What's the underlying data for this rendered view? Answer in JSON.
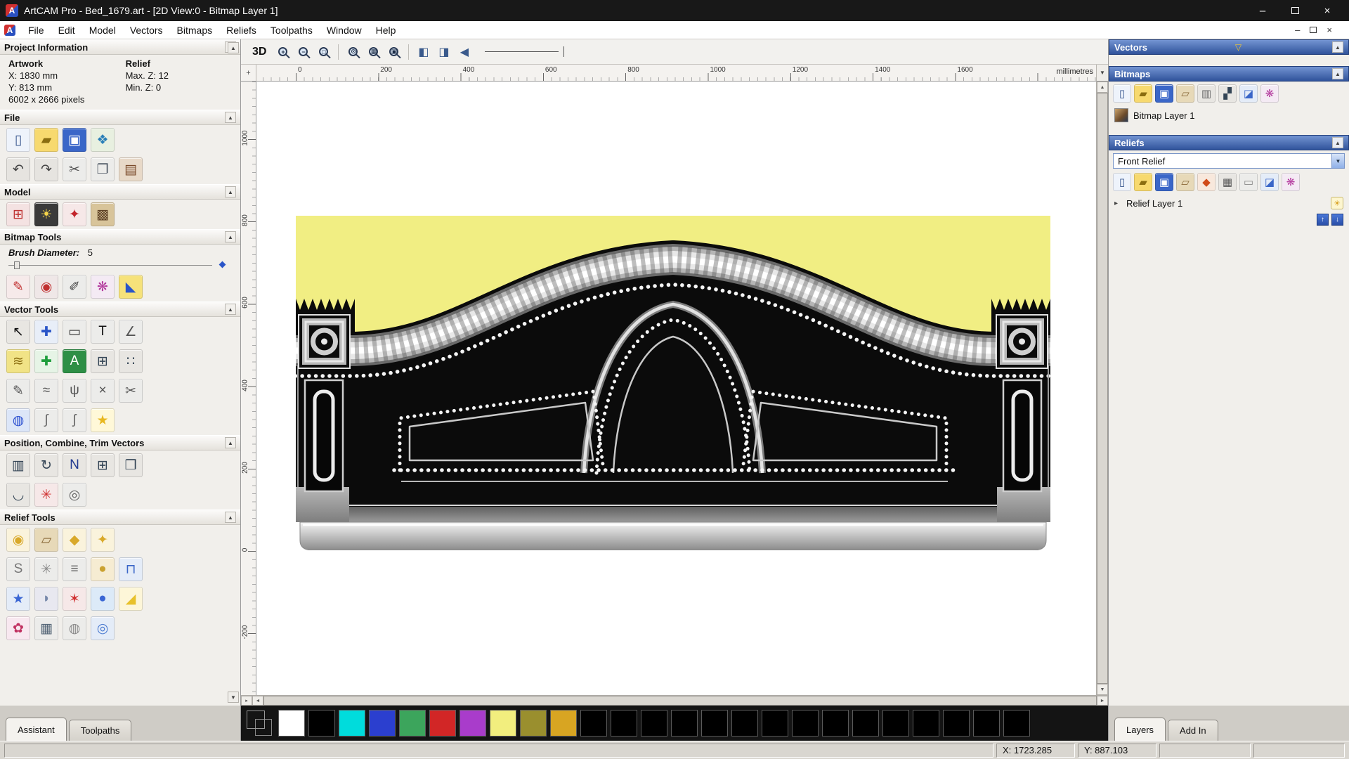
{
  "window": {
    "title": "ArtCAM Pro - Bed_1679.art - [2D View:0 - Bitmap Layer 1]",
    "controls": {
      "minimize": "–",
      "close": "×"
    }
  },
  "menu": {
    "items": [
      "File",
      "Edit",
      "Model",
      "Vectors",
      "Bitmaps",
      "Reliefs",
      "Toolpaths",
      "Window",
      "Help"
    ]
  },
  "left_panel": {
    "project_information": {
      "title": "Project Information",
      "artwork_label": "Artwork",
      "relief_label": "Relief",
      "artwork_x": "X: 1830 mm",
      "artwork_y": "Y: 813 mm",
      "artwork_pixels": "6002 x 2666 pixels",
      "relief_max_z": "Max. Z: 12",
      "relief_min_z": "Min. Z: 0"
    },
    "file": {
      "title": "File"
    },
    "model": {
      "title": "Model"
    },
    "bitmap_tools": {
      "title": "Bitmap Tools",
      "brush_label": "Brush Diameter:",
      "brush_value": "5"
    },
    "vector_tools": {
      "title": "Vector Tools"
    },
    "position_vectors": {
      "title": "Position, Combine, Trim Vectors"
    },
    "relief_tools": {
      "title": "Relief Tools"
    },
    "tabs": {
      "assistant": "Assistant",
      "toolpaths": "Toolpaths"
    }
  },
  "toolbar": {
    "view_3d": "3D",
    "zoom": [
      "+",
      "−",
      "□",
      "⊙",
      "▦",
      "▣"
    ],
    "extra": [
      "◧",
      "◨",
      "◀"
    ]
  },
  "canvas": {
    "ruler_h_labels": [
      "0",
      "200",
      "400",
      "600",
      "800",
      "1000",
      "1200",
      "1400",
      "1600"
    ],
    "ruler_v_labels": [
      "1000",
      "800",
      "600",
      "400",
      "200",
      "0",
      "-200"
    ],
    "units": "millimetres"
  },
  "right_panel": {
    "vectors_title": "Vectors",
    "bitmaps_title": "Bitmaps",
    "bitmap_layer_name": "Bitmap Layer 1",
    "reliefs_title": "Reliefs",
    "relief_set_name": "Front Relief",
    "relief_layer_name": "Relief Layer 1",
    "tabs": {
      "layers": "Layers",
      "add_in": "Add In"
    }
  },
  "palette": {
    "primary": "#ffffff",
    "secondary": "#000000",
    "colors": [
      "#ffffff",
      "#000000",
      "#00dcdc",
      "#2b3fcf",
      "#3ca55c",
      "#d22626",
      "#a93ccb",
      "#f2ee7e",
      "#9a8f2e",
      "#d8a522",
      "#000000",
      "#000000",
      "#000000",
      "#000000",
      "#000000",
      "#000000",
      "#000000",
      "#000000",
      "#000000",
      "#000000",
      "#000000",
      "#000000",
      "#000000",
      "#000000",
      "#000000"
    ]
  },
  "status_bar": {
    "x": "X: 1723.285",
    "y": "Y: 887.103"
  },
  "icons": {
    "logo": "A",
    "collapse": "▲",
    "expand": "▸",
    "dropdown": "▼",
    "filter": "▽",
    "light": "☀",
    "up": "↑",
    "down": "↓",
    "scroll_up": "▲",
    "scroll_down": "▼",
    "sb_up": "▲",
    "sb_down": "▼",
    "sb_left": "◄",
    "sb_right": "►",
    "hsb_btn": "▸",
    "origin": "+",
    "file_row1": [
      {
        "name": "new-model-icon",
        "glyph": "▯",
        "fg": "#34538c",
        "bg": "#eef3fb"
      },
      {
        "name": "open-model-icon",
        "glyph": "▰",
        "fg": "#8a6d10",
        "bg": "#f7d96e"
      },
      {
        "name": "save-model-icon",
        "glyph": "▣",
        "fg": "#ffffff",
        "bg": "#3a66c8"
      },
      {
        "name": "import-model-icon",
        "glyph": "❖",
        "fg": "#2a7fb8",
        "bg": "#e8f0e0"
      }
    ],
    "file_row2": [
      {
        "name": "undo-icon",
        "glyph": "↶",
        "fg": "#444444",
        "bg": "#e6e4e0"
      },
      {
        "name": "redo-icon",
        "glyph": "↷",
        "fg": "#444444",
        "bg": "#e6e4e0"
      },
      {
        "name": "cut-icon",
        "glyph": "✂",
        "fg": "#555555",
        "bg": "#ececea"
      },
      {
        "name": "copy-icon",
        "glyph": "❐",
        "fg": "#505a66",
        "bg": "#ececea"
      },
      {
        "name": "paste-icon",
        "glyph": "▤",
        "fg": "#7a4a2a",
        "bg": "#e8d9c8"
      }
    ],
    "model_row": [
      {
        "name": "set-model-size-icon",
        "glyph": "⊞",
        "fg": "#c03434",
        "bg": "#f4e2e2"
      },
      {
        "name": "adjust-lighting-icon",
        "glyph": "☀",
        "fg": "#f5d44a",
        "bg": "#3a3a3a"
      },
      {
        "name": "relief-envelope-icon",
        "glyph": "✦",
        "fg": "#c2242b",
        "bg": "#f6e8e8"
      },
      {
        "name": "greyscale-model-icon",
        "glyph": "▩",
        "fg": "#5d4024",
        "bg": "#d8c49a"
      }
    ],
    "bitmap_row": [
      {
        "name": "paint-icon",
        "glyph": "✎",
        "fg": "#c03030",
        "bg": "#f6eaea"
      },
      {
        "name": "flood-fill-icon",
        "glyph": "◉",
        "fg": "#c03030",
        "bg": "#efe7e7"
      },
      {
        "name": "colour-picker-icon",
        "glyph": "✐",
        "fg": "#444444",
        "bg": "#ececea"
      },
      {
        "name": "palette-icon",
        "glyph": "❋",
        "fg": "#b3399d",
        "bg": "#f4eaf4"
      },
      {
        "name": "bucket-fill-icon",
        "glyph": "◣",
        "fg": "#2a55c8",
        "bg": "#f6e27a"
      }
    ],
    "vector_row1": [
      {
        "name": "select-vectors-icon",
        "glyph": "↖",
        "fg": "#111111",
        "bg": "#e8e6e2"
      },
      {
        "name": "transform-vectors-icon",
        "glyph": "✚",
        "fg": "#2a55c8",
        "bg": "#e8eef8"
      },
      {
        "name": "create-rectangle-icon",
        "glyph": "▭",
        "fg": "#333333",
        "bg": "#ececea"
      },
      {
        "name": "create-text-icon",
        "glyph": "T",
        "fg": "#111111",
        "bg": "#ececea"
      },
      {
        "name": "measure-icon",
        "glyph": "∠",
        "fg": "#555555",
        "bg": "#ececea"
      }
    ],
    "vector_row2": [
      {
        "name": "fit-vectors-icon",
        "glyph": "≋",
        "fg": "#8a6d10",
        "bg": "#f1e386"
      },
      {
        "name": "node-editing-icon",
        "glyph": "✚",
        "fg": "#1f9e3d",
        "bg": "#e6f4e6"
      },
      {
        "name": "text-block-icon",
        "glyph": "A",
        "fg": "#ffffff",
        "bg": "#2e8f46"
      },
      {
        "name": "snap-grid-icon",
        "glyph": "⊞",
        "fg": "#334455",
        "bg": "#e8e6e2"
      },
      {
        "name": "snap-points-icon",
        "glyph": "∷",
        "fg": "#334455",
        "bg": "#e8e6e2"
      }
    ],
    "vector_row3": [
      {
        "name": "freehand-draw-icon",
        "glyph": "✎",
        "fg": "#555555",
        "bg": "#ececea"
      },
      {
        "name": "smooth-curve-icon",
        "glyph": "≈",
        "fg": "#555555",
        "bg": "#ececea"
      },
      {
        "name": "bezier-curve-icon",
        "glyph": "ψ",
        "fg": "#555555",
        "bg": "#ececea"
      },
      {
        "name": "delete-span-icon",
        "glyph": "×",
        "fg": "#555555",
        "bg": "#ececea"
      },
      {
        "name": "trim-vectors-icon",
        "glyph": "✂",
        "fg": "#555555",
        "bg": "#ececea"
      }
    ],
    "vector_row4": [
      {
        "name": "create-circle-icon",
        "glyph": "◍",
        "fg": "#2a4fd0",
        "bg": "#dce6f8"
      },
      {
        "name": "create-curve-icon",
        "glyph": "∫",
        "fg": "#666666",
        "bg": "#ececea"
      },
      {
        "name": "distort-vectors-icon",
        "glyph": "ʃ",
        "fg": "#666666",
        "bg": "#ececea"
      },
      {
        "name": "create-star-icon",
        "glyph": "★",
        "fg": "#e8b820",
        "bg": "#fff8d8"
      }
    ],
    "position_row1": [
      {
        "name": "align-vectors-icon",
        "glyph": "▥",
        "fg": "#334455",
        "bg": "#e8e6e2"
      },
      {
        "name": "rotate-vectors-icon",
        "glyph": "↻",
        "fg": "#334455",
        "bg": "#e8e6e2"
      },
      {
        "name": "nesting-icon",
        "glyph": "N",
        "fg": "#223a8f",
        "bg": "#e8e6e2"
      },
      {
        "name": "block-copy-icon",
        "glyph": "⊞",
        "fg": "#334455",
        "bg": "#e8e6e2"
      },
      {
        "name": "copy-rotate-icon",
        "glyph": "❒",
        "fg": "#334455",
        "bg": "#e8e6e2"
      }
    ],
    "position_row2": [
      {
        "name": "mirror-vectors-icon",
        "glyph": "◡",
        "fg": "#334455",
        "bg": "#e8e6e2"
      },
      {
        "name": "weld-vectors-icon",
        "glyph": "✳",
        "fg": "#d03030",
        "bg": "#f6e8e8"
      },
      {
        "name": "spiral-icon",
        "glyph": "◎",
        "fg": "#666666",
        "bg": "#ececea"
      }
    ],
    "relief_row1": [
      {
        "name": "shape-editor-icon",
        "glyph": "◉",
        "fg": "#d9a92a",
        "bg": "#faf3dc"
      },
      {
        "name": "extrude-icon",
        "glyph": "▱",
        "fg": "#8a6a3a",
        "bg": "#e7d9b8"
      },
      {
        "name": "spin-icon",
        "glyph": "◆",
        "fg": "#d9a92a",
        "bg": "#faf3dc"
      },
      {
        "name": "turn-icon",
        "glyph": "✦",
        "fg": "#d9a92a",
        "bg": "#faf3dc"
      }
    ],
    "relief_row2": [
      {
        "name": "smooth-relief-icon",
        "glyph": "S",
        "fg": "#777777",
        "bg": "#ececea"
      },
      {
        "name": "weave-wizard-icon",
        "glyph": "✳",
        "fg": "#8a8a8a",
        "bg": "#ececea"
      },
      {
        "name": "offset-relief-icon",
        "glyph": "≡",
        "fg": "#666666",
        "bg": "#ececea"
      },
      {
        "name": "sculpt-icon",
        "glyph": "●",
        "fg": "#caa12f",
        "bg": "#f6ecd2"
      },
      {
        "name": "dynamic-sculpt-icon",
        "glyph": "⊓",
        "fg": "#3a66c8",
        "bg": "#e4ecf8"
      }
    ],
    "relief_row3": [
      {
        "name": "star-wizard-icon",
        "glyph": "★",
        "fg": "#3a66d4",
        "bg": "#e4ecf8"
      },
      {
        "name": "cushion-relief-icon",
        "glyph": "◗",
        "fg": "#7788aa",
        "bg": "#e8e8f0"
      },
      {
        "name": "airbrush-relief-icon",
        "glyph": "✶",
        "fg": "#d03030",
        "bg": "#f6e8e8"
      },
      {
        "name": "texture-relief-icon",
        "glyph": "●",
        "fg": "#3a66d4",
        "bg": "#dceaf8"
      },
      {
        "name": "angle-relief-icon",
        "glyph": "◢",
        "fg": "#e8c12a",
        "bg": "#fdf6d8"
      }
    ],
    "relief_row4": [
      {
        "name": "isolate-relief-icon",
        "glyph": "✿",
        "fg": "#c03060",
        "bg": "#f8e8f0"
      },
      {
        "name": "mesh-relief-icon",
        "glyph": "▦",
        "fg": "#556677",
        "bg": "#ececea"
      },
      {
        "name": "face-wizard-icon",
        "glyph": "◍",
        "fg": "#888888",
        "bg": "#ececea"
      },
      {
        "name": "swirl-relief-icon",
        "glyph": "◎",
        "fg": "#4a7ad0",
        "bg": "#e4ecf8"
      }
    ],
    "bitmaps_toolbar": [
      {
        "name": "new-bitmap-icon",
        "glyph": "▯",
        "fg": "#34538c",
        "bg": "#eef3fb"
      },
      {
        "name": "open-bitmap-icon",
        "glyph": "▰",
        "fg": "#8a6d10",
        "bg": "#f7d96e"
      },
      {
        "name": "save-bitmap-icon",
        "glyph": "▣",
        "fg": "#ffffff",
        "bg": "#3a66c8"
      },
      {
        "name": "bitmap-options-icon",
        "glyph": "▱",
        "fg": "#8a6a3a",
        "bg": "#e7d9b8"
      },
      {
        "name": "greyscale-bitmap-icon",
        "glyph": "▥",
        "fg": "#666666",
        "bg": "#e8e6e2"
      },
      {
        "name": "compare-bitmap-icon",
        "glyph": "▞",
        "fg": "#334455",
        "bg": "#e8e6e2"
      },
      {
        "name": "delete-bitmap-icon",
        "glyph": "◪",
        "fg": "#3a66c8",
        "bg": "#e4ecf8"
      },
      {
        "name": "bitmap-palette-icon",
        "glyph": "❋",
        "fg": "#b3399d",
        "bg": "#f4eaf4"
      }
    ],
    "reliefs_toolbar": [
      {
        "name": "new-relief-icon",
        "glyph": "▯",
        "fg": "#34538c",
        "bg": "#eef3fb"
      },
      {
        "name": "open-relief-icon",
        "glyph": "▰",
        "fg": "#8a6d10",
        "bg": "#f7d96e"
      },
      {
        "name": "save-relief-icon",
        "glyph": "▣",
        "fg": "#ffffff",
        "bg": "#3a66c8"
      },
      {
        "name": "paste-relief-icon",
        "glyph": "▱",
        "fg": "#8a6a3a",
        "bg": "#e7d9b8"
      },
      {
        "name": "relief-jewel-icon",
        "glyph": "◆",
        "fg": "#d04a18",
        "bg": "#f8e8dc"
      },
      {
        "name": "calculate-relief-icon",
        "glyph": "▦",
        "fg": "#555555",
        "bg": "#e8e6e2"
      },
      {
        "name": "reset-relief-icon",
        "glyph": "▭",
        "fg": "#888888",
        "bg": "#ececea"
      },
      {
        "name": "delete-relief-icon",
        "glyph": "◪",
        "fg": "#3a66c8",
        "bg": "#e4ecf8"
      },
      {
        "name": "relief-palette-icon",
        "glyph": "❋",
        "fg": "#b3399d",
        "bg": "#f4eaf4"
      }
    ]
  }
}
